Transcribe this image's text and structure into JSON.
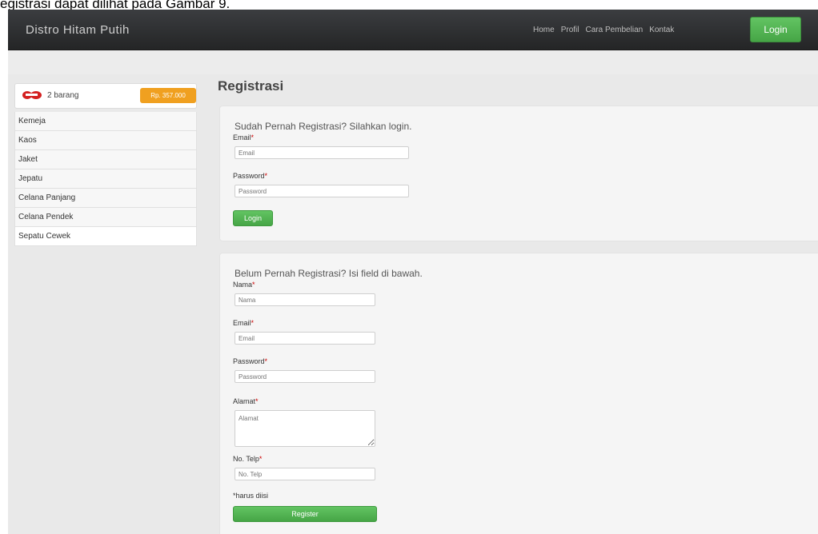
{
  "caption": "egistrasi dapat dilihat pada Gambar 9.",
  "navbar": {
    "brand": "Distro Hitam Putih",
    "links": [
      "Home",
      "Profil",
      "Cara Pembelian",
      "Kontak"
    ],
    "login_label": "Login"
  },
  "sidebar": {
    "cart_count": "2 barang",
    "cart_total": "Rp. 357.000",
    "categories": [
      "Kemeja",
      "Kaos",
      "Jaket",
      "Jepatu",
      "Celana Panjang",
      "Celana Pendek",
      "Sepatu Cewek"
    ]
  },
  "page_title": "Registrasi",
  "login_form": {
    "heading": "Sudah Pernah Registrasi? Silahkan login.",
    "email_label": "Email",
    "email_placeholder": "Email",
    "password_label": "Password",
    "password_placeholder": "Password",
    "submit_label": "Login"
  },
  "register_form": {
    "heading": "Belum Pernah Registrasi? Isi field di bawah.",
    "name_label": "Nama",
    "name_placeholder": "Nama",
    "email_label": "Email",
    "email_placeholder": "Email",
    "password_label": "Password",
    "password_placeholder": "Password",
    "address_label": "Alamat",
    "address_placeholder": "Alamat",
    "phone_label": "No. Telp",
    "phone_placeholder": "No. Telp",
    "required_note": "*harus diisi",
    "submit_label": "Register"
  },
  "colors": {
    "navbar": "#2d2e30",
    "accent_green": "#51b151",
    "cart_badge": "#f0a020",
    "background": "#e9e9e9"
  },
  "icons": {
    "cart": "cart-icon"
  }
}
